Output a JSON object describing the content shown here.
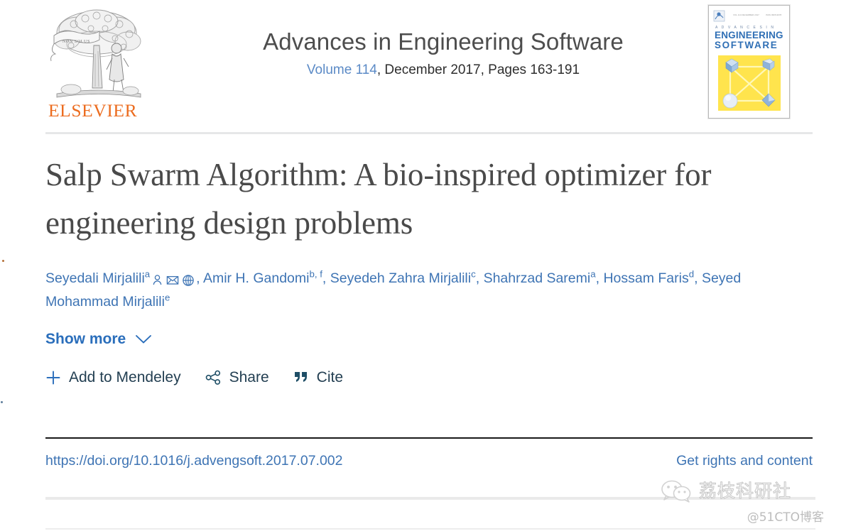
{
  "publisher": {
    "name": "ELSEVIER",
    "logo_icon": "elsevier-tree-logo",
    "wordmark_color": "#ec6c1f"
  },
  "journal": {
    "title": "Advances in Engineering Software",
    "volume_label": "Volume 114",
    "issue_meta": ", December 2017, Pages 163-191",
    "volume_link_color": "#5b8ac6",
    "cover": {
      "line1": "A D V A N C E S   I N",
      "line2": "ENGINEERING",
      "line3": "SOFTWARE",
      "accent_color": "#2f6fb5",
      "graphic_color": "#ffe44d",
      "icon": "journal-cover-thumbnail"
    }
  },
  "article": {
    "title": "Salp Swarm Algorithm: A bio-inspired optimizer for engineering design problems",
    "authors": [
      {
        "name": "Seyedali Mirjalili",
        "sup": "a",
        "icons": [
          "author-profile-icon",
          "author-email-icon",
          "author-website-icon"
        ]
      },
      {
        "name": "Amir H. Gandomi",
        "sup": "b, f",
        "icons": []
      },
      {
        "name": "Seyedeh Zahra Mirjalili",
        "sup": "c",
        "icons": []
      },
      {
        "name": "Shahrzad Saremi",
        "sup": "a",
        "icons": []
      },
      {
        "name": "Hossam Faris",
        "sup": "d",
        "icons": []
      },
      {
        "name": "Seyed Mohammad Mirjalili",
        "sup": "e",
        "icons": []
      }
    ],
    "author_link_color": "#3e74b4",
    "show_more_label": "Show more",
    "show_more_icon": "chevron-down-icon",
    "doi_url": "https://doi.org/10.1016/j.advengsoft.2017.07.002",
    "rights_label": "Get rights and content"
  },
  "actions": [
    {
      "label": "Add to Mendeley",
      "icon": "plus-icon"
    },
    {
      "label": "Share",
      "icon": "share-network-icon"
    },
    {
      "label": "Cite",
      "icon": "quote-marks-icon"
    }
  ],
  "watermark": {
    "brand": "荔枝科研社",
    "source": "@51CTO博客",
    "icon": "wechat-icon"
  }
}
